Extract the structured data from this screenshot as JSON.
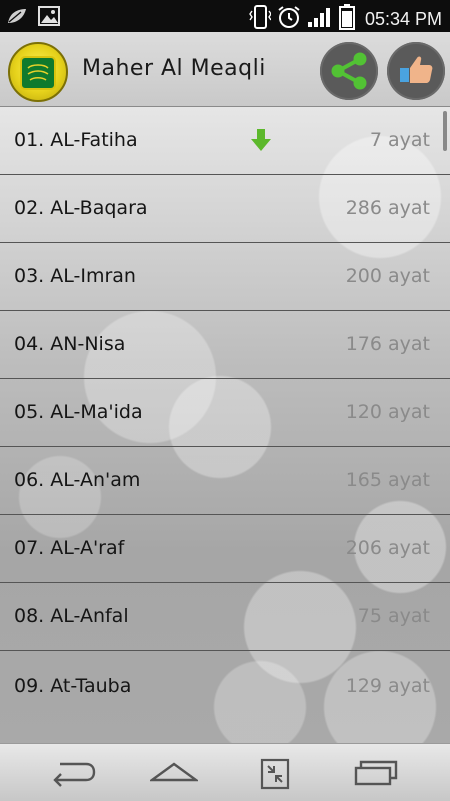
{
  "status_bar": {
    "time": "05:34 PM",
    "icons": [
      "leaf-icon",
      "image-icon",
      "phone-vibrate-icon",
      "alarm-icon",
      "signal-icon",
      "battery-icon"
    ]
  },
  "app": {
    "title": "Maher Al Meaqli",
    "colors": {
      "logo": "#e6d21b",
      "share": "#4caf50",
      "accent_dl": "#5cb82b"
    }
  },
  "surahs": [
    {
      "name": "01. AL-Fatiha",
      "ayat": "7 ayat",
      "downloaded": true
    },
    {
      "name": "02. AL-Baqara",
      "ayat": "286 ayat"
    },
    {
      "name": "03. AL-Imran",
      "ayat": "200 ayat"
    },
    {
      "name": "04. AN-Nisa",
      "ayat": "176 ayat"
    },
    {
      "name": "05. AL-Ma'ida",
      "ayat": "120 ayat"
    },
    {
      "name": "06. AL-An'am",
      "ayat": "165 ayat"
    },
    {
      "name": "07. AL-A'raf",
      "ayat": "206 ayat"
    },
    {
      "name": "08. AL-Anfal",
      "ayat": "75 ayat"
    },
    {
      "name": "09. At-Tauba",
      "ayat": "129 ayat"
    }
  ],
  "nav": [
    "back-icon",
    "home-icon",
    "recent-apps-icon",
    "multitask-icon"
  ]
}
